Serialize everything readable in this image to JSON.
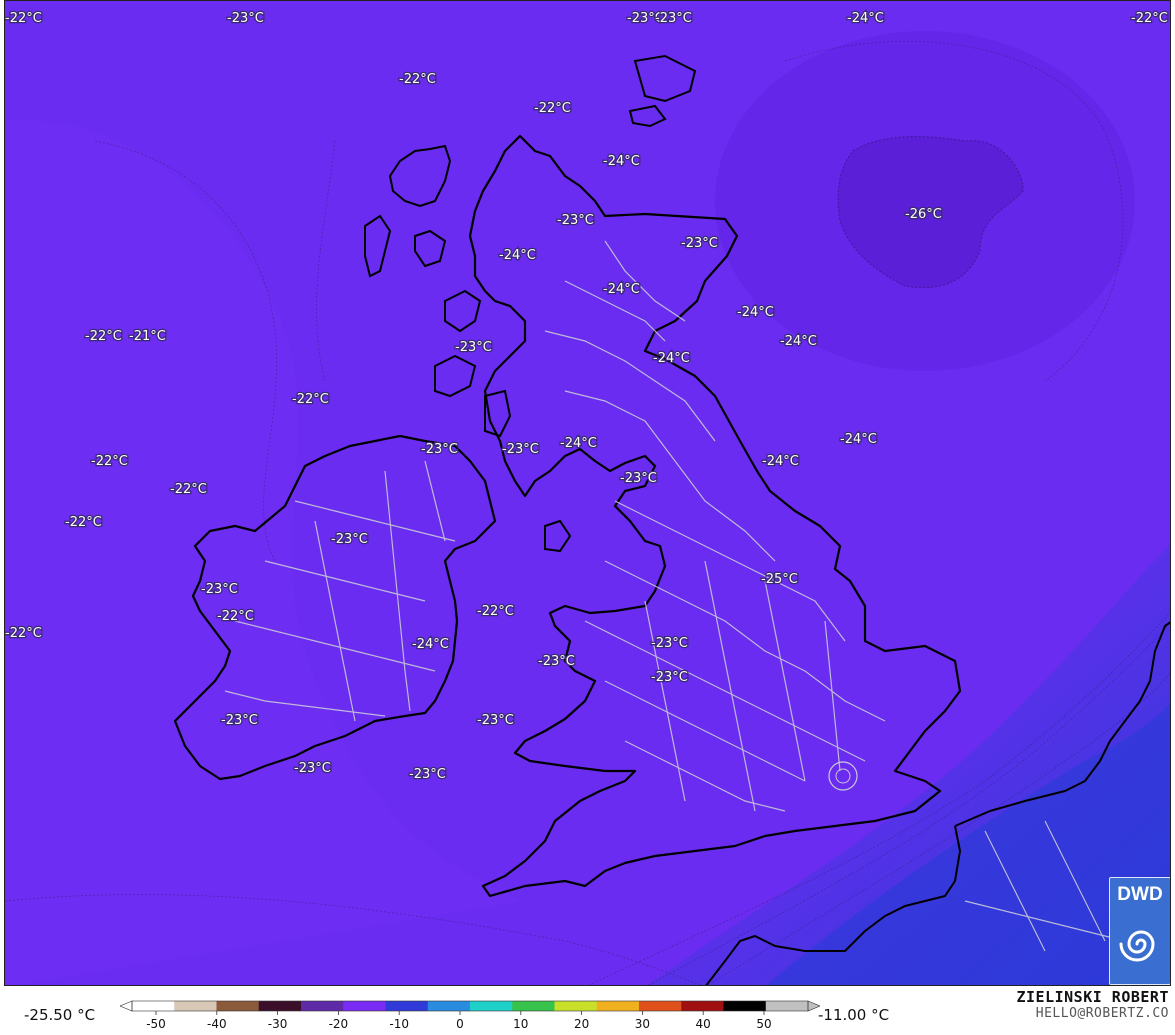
{
  "map": {
    "unit": "°C",
    "temperature_labels": [
      {
        "text": "-22°C"
      },
      {
        "text": "-23°C"
      },
      {
        "text": "-23°C"
      },
      {
        "text": "-24°C"
      },
      {
        "text": "-22°C"
      },
      {
        "text": "-22°C"
      },
      {
        "text": "-22°C"
      },
      {
        "text": "-24°C"
      },
      {
        "text": "-26°C"
      },
      {
        "text": "-23°C"
      },
      {
        "text": "-23°C"
      },
      {
        "text": "-24°C"
      },
      {
        "text": "-24°C"
      },
      {
        "text": "-24°C"
      },
      {
        "text": "-24°C"
      },
      {
        "text": "-22°C"
      },
      {
        "text": "-21°C"
      },
      {
        "text": "-23°C"
      },
      {
        "text": "-24°C"
      },
      {
        "text": "-24°C"
      },
      {
        "text": "-22°C"
      },
      {
        "text": "-23°C"
      },
      {
        "text": "-24°C"
      },
      {
        "text": "-23°C"
      },
      {
        "text": "-22°C"
      },
      {
        "text": "-22°C"
      },
      {
        "text": "-24°C"
      },
      {
        "text": "-23°C"
      },
      {
        "text": "-22°C"
      },
      {
        "text": "-23°C"
      },
      {
        "text": "-25°C"
      },
      {
        "text": "-23°C"
      },
      {
        "text": "-22°C"
      },
      {
        "text": "-22°C"
      },
      {
        "text": "-22°C"
      },
      {
        "text": "-23°C"
      },
      {
        "text": "-23°C"
      },
      {
        "text": "-24°C"
      },
      {
        "text": "-23°C"
      },
      {
        "text": "-23°C"
      },
      {
        "text": "-23°C"
      },
      {
        "text": "-23°C"
      },
      {
        "text": "-23°C"
      },
      {
        "text": "-23°C"
      }
    ]
  },
  "legend": {
    "min_label": "-25.50 °C",
    "max_label": "-11.00 °C",
    "ticks": [
      "-50",
      "-40",
      "-30",
      "-20",
      "-10",
      "0",
      "10",
      "20",
      "30",
      "40",
      "50"
    ],
    "colors": [
      "#ffffff",
      "#d9c8b6",
      "#8a5a3a",
      "#3b0f2a",
      "#5e2aa8",
      "#7a2cf5",
      "#2f3ad8",
      "#2a8ce0",
      "#1fd0c8",
      "#37c24b",
      "#c8e02a",
      "#f0b020",
      "#e0501a",
      "#a01010",
      "#000000",
      "#c0c0c0"
    ]
  },
  "credits": {
    "author": "ZIELINSKI ROBERT",
    "email": "HELLO@ROBERTZ.CO",
    "logo_text": "DWD"
  },
  "colors": {
    "land_outline": "#000000",
    "border_lines": "#c8c8d8",
    "field_main": "#6a2cf0",
    "field_cold": "#5a22d8",
    "field_warm": "#2f3ad8"
  }
}
